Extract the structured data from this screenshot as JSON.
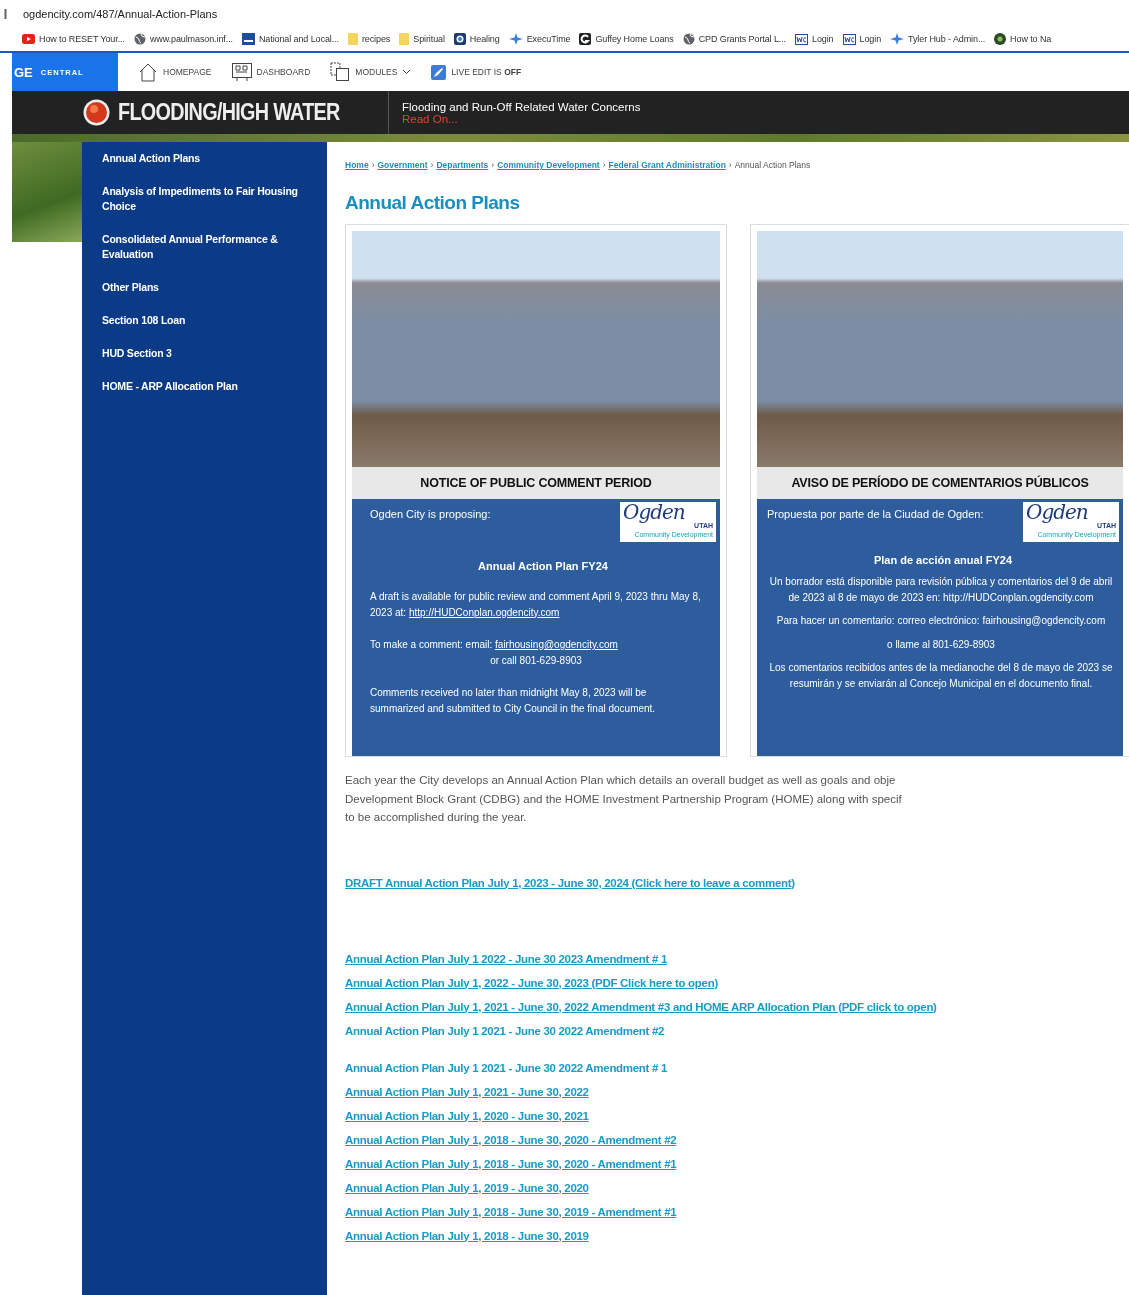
{
  "address_bar": {
    "url": "ogdencity.com/487/Annual-Action-Plans"
  },
  "bookmarks": [
    {
      "kind": "video",
      "label": "How to RESET Your..."
    },
    {
      "kind": "globe",
      "label": "www.paulmason.inf..."
    },
    {
      "kind": "image",
      "label": "National and Local..."
    },
    {
      "kind": "folder",
      "label": "recipes"
    },
    {
      "kind": "folder",
      "label": "Spiritual"
    },
    {
      "kind": "badge",
      "label": "Healing"
    },
    {
      "kind": "star",
      "label": "ExecuTime"
    },
    {
      "kind": "letter",
      "label": "Guffey Home Loans"
    },
    {
      "kind": "globe",
      "label": "CPD Grants Portal L..."
    },
    {
      "kind": "wc",
      "label": "Login"
    },
    {
      "kind": "wc",
      "label": "Login"
    },
    {
      "kind": "star",
      "label": "Tyler Hub - Admin..."
    },
    {
      "kind": "dot",
      "label": "How to Na"
    }
  ],
  "admin_bar": {
    "logo": "GE",
    "logo_sub": "CENTRAL",
    "items": [
      {
        "kind": "home",
        "label": "HOMEPAGE"
      },
      {
        "kind": "dashboard",
        "label": "DASHBOARD"
      },
      {
        "kind": "modules",
        "label": "MODULES"
      },
      {
        "kind": "edit",
        "label": "LIVE EDIT IS **OFF**"
      }
    ]
  },
  "alert": {
    "title": "FLOODING/HIGH WATER",
    "message": "Flooding and Run-Off Related Water Concerns",
    "link": "Read On..."
  },
  "sidebar": {
    "items": [
      "Annual Action Plans",
      "Analysis of Impediments to Fair Housing Choice",
      "Consolidated Annual Performance & Evaluation",
      "Other Plans",
      "Section 108 Loan",
      "HUD Section 3",
      "HOME - ARP Allocation Plan"
    ]
  },
  "breadcrumb": [
    {
      "kind": "link",
      "text": "Home"
    },
    {
      "kind": "sep",
      "text": "›"
    },
    {
      "kind": "link",
      "text": "Government"
    },
    {
      "kind": "sep",
      "text": "›"
    },
    {
      "kind": "link",
      "text": "Departments"
    },
    {
      "kind": "sep",
      "text": "›"
    },
    {
      "kind": "link",
      "text": "Community Development"
    },
    {
      "kind": "sep",
      "text": "›"
    },
    {
      "kind": "link",
      "text": "Federal Grant Administration"
    },
    {
      "kind": "sep",
      "text": "›"
    },
    {
      "kind": "current",
      "text": "Annual Action Plans"
    }
  ],
  "title": "Annual Action Plans",
  "flyers": [
    {
      "header": "NOTICE OF PUBLIC COMMENT PERIOD",
      "intro": "Ogden City is proposing:",
      "logo": {
        "word": "Ogden",
        "state": "UTAH",
        "sub": "Community Development"
      },
      "heading": "Annual Action Plan FY24",
      "paragraphs": [
        {
          "parts": [
            {
              "kind": "text",
              "text": "A draft is available for public review and comment April 9, 2023 thru May 8, 2023 at: "
            },
            {
              "kind": "link",
              "text": "http://HUDConplan.ogdencity.com"
            }
          ]
        },
        {
          "parts": [
            {
              "kind": "text",
              "text": "To make a comment: email:  "
            },
            {
              "kind": "link",
              "text": "fairhousing@ogdencity.com"
            },
            {
              "kind": "line",
              "text": "or call 801-629-8903"
            }
          ]
        },
        {
          "parts": [
            {
              "kind": "text",
              "text": "Comments received no later than midnight May 8, 2023 will be summarized and submitted to City Council in the final document."
            }
          ]
        }
      ]
    },
    {
      "header": "AVISO DE PERÍODO DE COMENTARIOS PÚBLICOS",
      "intro": "Propuesta por parte de la Ciudad de Ogden:",
      "logo": {
        "word": "Ogden",
        "state": "UTAH",
        "sub": "Community Development"
      },
      "heading": "Plan de acción anual FY24",
      "paragraphs": [
        {
          "parts": [
            {
              "kind": "text",
              "text": "Un borrador está disponible para revisión pública y comentarios del 9 de abril de 2023 al 8 de mayo de 2023 en: http://HUDConplan.ogdencity.com"
            }
          ]
        },
        {
          "parts": [
            {
              "kind": "text",
              "text": "Para hacer un comentario: correo electrónico: fairhousing@ogdencity.com"
            }
          ]
        },
        {
          "parts": [
            {
              "kind": "text",
              "text": "o llame al 801-629-8903"
            }
          ]
        },
        {
          "parts": [
            {
              "kind": "text",
              "text": "Los comentarios recibidos antes de la medianoche del 8 de mayo de 2023 se resumirán y se enviarán al Concejo Municipal en el documento final."
            }
          ]
        }
      ]
    }
  ],
  "description": [
    "Each year the City develops an Annual Action Plan which details an overall budget as well as goals and obje",
    "Development Block Grant (CDBG) and the HOME Investment Partnership Program (HOME) along with specif",
    "to be accomplished during the year."
  ],
  "link_groups": [
    [
      {
        "text": "DRAFT Annual Action Plan July 1, 2023 - June 30, 2024 (Click here to leave a comment)",
        "underlined": true
      }
    ],
    [
      {
        "text": "Annual Action Plan July 1 2022 - June 30 2023 Amendment # 1",
        "underlined": true
      },
      {
        "text": "Annual Action Plan July 1, 2022 - June 30, 2023 (PDF Click here to open)",
        "underlined": true
      },
      {
        "text": "Annual Action Plan July 1, 2021 - June 30, 2022 Amendment #3 and HOME ARP Allocation Plan (PDF click to open)",
        "underlined": true
      },
      {
        "text": "Annual Action Plan July 1 2021 - June 30 2022 Amendment #2",
        "underlined": false
      }
    ],
    [
      {
        "text": "Annual Action Plan July 1 2021 - June 30 2022 Amendment # 1",
        "underlined": false
      },
      {
        "text": "Annual Action Plan July 1, 2021 - June 30, 2022",
        "underlined": true
      },
      {
        "text": "Annual Action Plan July 1, 2020 - June 30, 2021",
        "underlined": true
      },
      {
        "text": "Annual Action Plan July 1, 2018 - June 30, 2020 - Amendment #2",
        "underlined": true
      },
      {
        "text": "Annual Action Plan July 1, 2018 - June 30, 2020 - Amendment #1",
        "underlined": true
      },
      {
        "text": "Annual Action Plan July 1, 2019 - June 30, 2020",
        "underlined": true
      },
      {
        "text": "Annual Action Plan July 1, 2018 - June 30, 2019 - Amendment #1",
        "underlined": true
      },
      {
        "text": "Annual Action Plan July 1, 2018 - June 30, 2019",
        "underlined": true
      }
    ]
  ]
}
